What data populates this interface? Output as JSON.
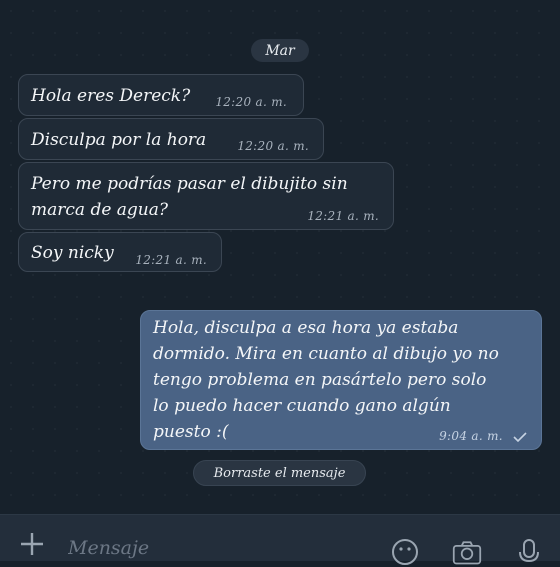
{
  "chat": {
    "day_label": "Mar",
    "messages": [
      {
        "text": "Hola eres Dereck?",
        "time": "12:20 a. m."
      },
      {
        "text": "Disculpa por la hora",
        "time": "12:20 a. m."
      },
      {
        "text": "Pero me podrías pasar el dibujito sin\nmarca de agua?",
        "time": "12:21 a. m."
      },
      {
        "text": "Soy nicky",
        "time": "12:21 a. m."
      },
      {
        "text": "Hola, disculpa a esa hora ya estaba\ndormido. Mira en cuanto al dibujo yo no\ntengo problema en pasártelo pero solo\nlo puedo hacer cuando gano algún\npuesto :(",
        "time": "9:04 a. m."
      }
    ],
    "deleted_notice": "Borraste el mensaje"
  },
  "input": {
    "placeholder": "Mensaje"
  },
  "icons": {
    "attach": "plus-icon",
    "emoji": "emoji-icon",
    "camera": "camera-icon",
    "mic": "microphone-icon",
    "read_status": "check-icon"
  },
  "colors": {
    "background": "#17212b",
    "incoming_bubble": "#1f2a36",
    "outgoing_bubble": "#4a6385",
    "input_bar": "#232e3b"
  }
}
